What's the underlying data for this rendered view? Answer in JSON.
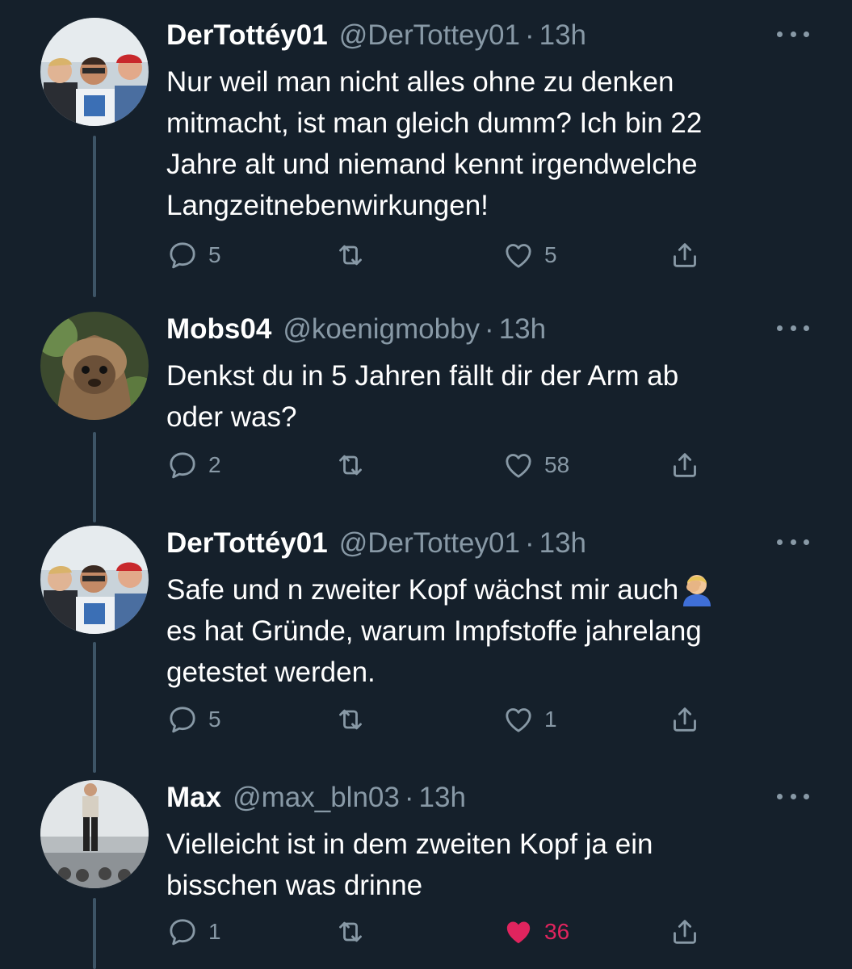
{
  "colors": {
    "background": "#15202b",
    "text_primary": "#ffffff",
    "text_secondary": "#8899a6",
    "thread_line": "#3d5466",
    "like_active": "#e0245e"
  },
  "tweets": [
    {
      "display_name": "DerTottéy01",
      "handle": "@DerTottey01",
      "separator": "·",
      "time": "13h",
      "text": "Nur weil man nicht alles ohne zu denken\nmitmacht, ist man gleich dumm? Ich bin 22\nJahre alt und niemand kennt irgendwelche\nLangzeitnebenwirkungen!",
      "replies": "5",
      "retweets": "",
      "likes": "5",
      "liked": false,
      "avatar_icon": "group-photo-avatar"
    },
    {
      "display_name": "Mobs04",
      "handle": "@koenigmobby",
      "separator": "·",
      "time": "13h",
      "text": "Denkst du in 5 Jahren fällt dir der Arm ab\noder was?",
      "replies": "2",
      "retweets": "",
      "likes": "58",
      "liked": false,
      "avatar_icon": "ewok-avatar"
    },
    {
      "display_name": "DerTottéy01",
      "handle": "@DerTottey01",
      "separator": "·",
      "time": "13h",
      "text_line1": "Safe und n zweiter Kopf wächst mir auch",
      "text_rest": "es hat Gründe, warum Impfstoffe jahrelang\ngetestet werden.",
      "emoji_icon": "facepalm-emoji",
      "replies": "5",
      "retweets": "",
      "likes": "1",
      "liked": false,
      "avatar_icon": "group-photo-avatar"
    },
    {
      "display_name": "Max",
      "handle": "@max_bln03",
      "separator": "·",
      "time": "13h",
      "text": "Vielleicht ist in dem zweiten Kopf ja ein\nbisschen was drinne",
      "replies": "1",
      "retweets": "",
      "likes": "36",
      "liked": true,
      "avatar_icon": "person-standing-avatar"
    }
  ]
}
